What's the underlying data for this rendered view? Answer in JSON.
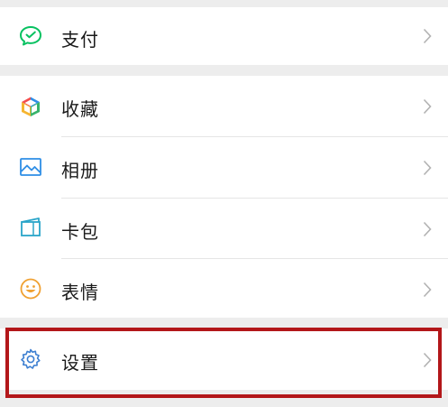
{
  "menu": {
    "pay": {
      "label": "支付",
      "icon": "wechat-pay-icon",
      "color": "#07c160"
    },
    "favorites": {
      "label": "收藏",
      "icon": "cube-icon"
    },
    "album": {
      "label": "相册",
      "icon": "photo-icon",
      "color": "#2e8ee6"
    },
    "cards": {
      "label": "卡包",
      "icon": "card-wallet-icon",
      "color": "#2aa5c9"
    },
    "stickers": {
      "label": "表情",
      "icon": "smiley-icon",
      "color": "#f0a132"
    },
    "settings": {
      "label": "设置",
      "icon": "gear-icon",
      "color": "#3d7fd1"
    }
  },
  "highlight_color": "#b3171a"
}
